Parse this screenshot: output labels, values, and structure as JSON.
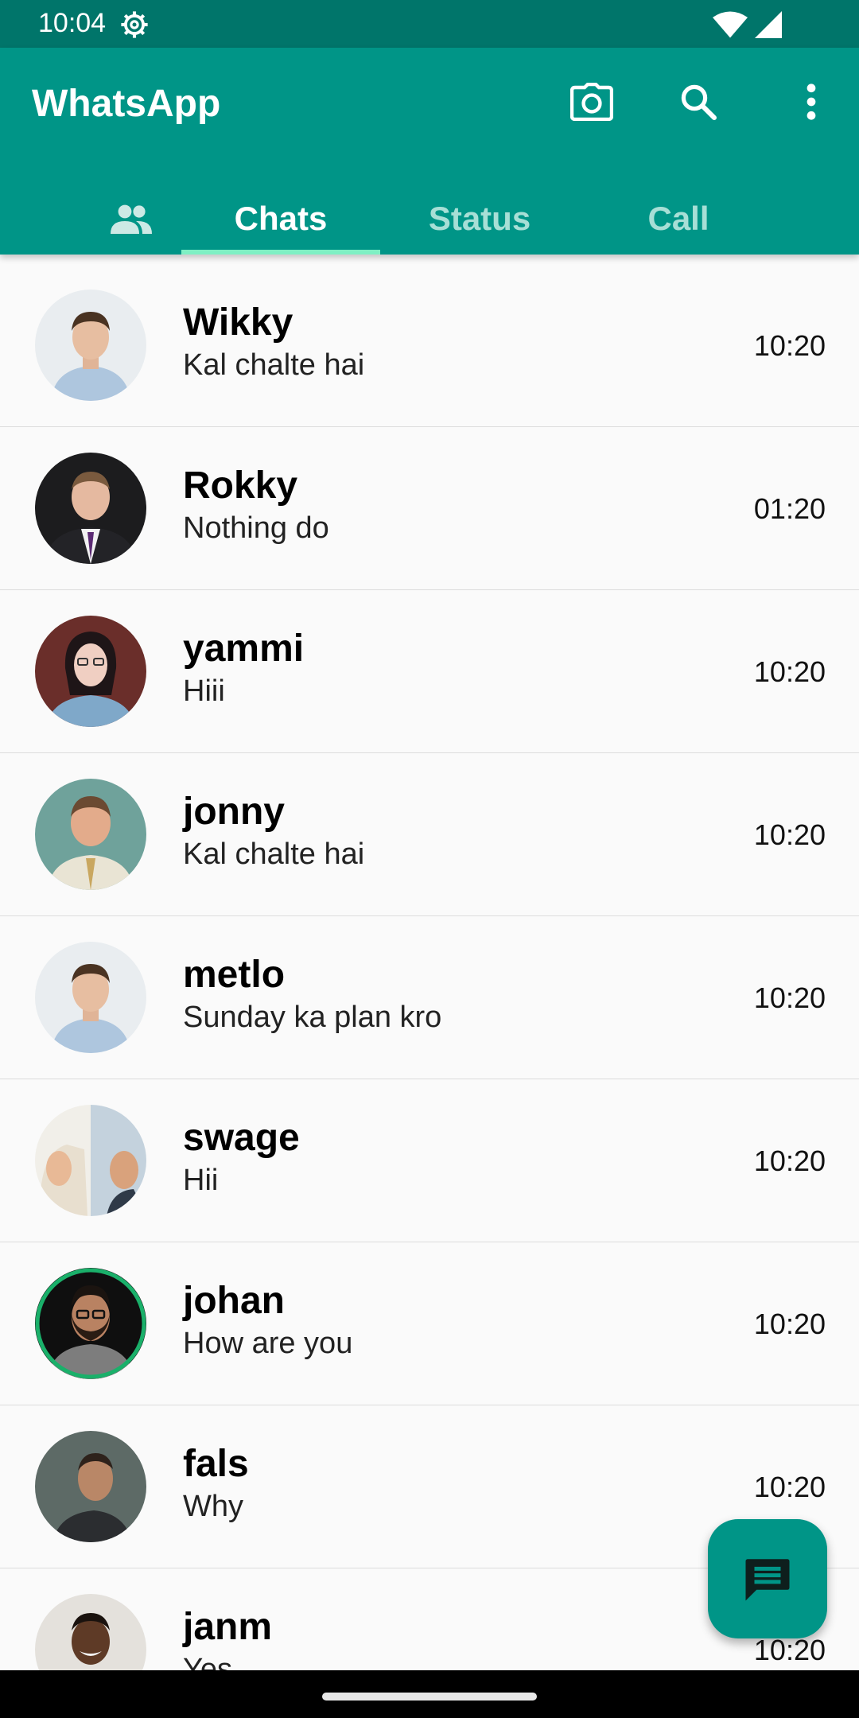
{
  "status_bar": {
    "time": "10:04"
  },
  "app_bar": {
    "title": "WhatsApp",
    "tabs": [
      {
        "label": "Chats",
        "selected": true
      },
      {
        "label": "Status",
        "selected": false
      },
      {
        "label": "Call",
        "selected": false
      }
    ]
  },
  "chats": [
    {
      "name": "Wikky",
      "message": "Kal chalte hai",
      "time": "10:20"
    },
    {
      "name": "Rokky",
      "message": "Nothing do",
      "time": "01:20"
    },
    {
      "name": "yammi",
      "message": "Hiii",
      "time": "10:20"
    },
    {
      "name": "jonny",
      "message": "Kal chalte hai",
      "time": "10:20"
    },
    {
      "name": "metlo",
      "message": "Sunday ka plan kro",
      "time": "10:20"
    },
    {
      "name": "swage",
      "message": "Hii",
      "time": "10:20"
    },
    {
      "name": "johan",
      "message": "How are you",
      "time": "10:20"
    },
    {
      "name": "fals",
      "message": "Why",
      "time": "10:20"
    },
    {
      "name": "janm",
      "message": "Yes",
      "time": "10:20"
    }
  ],
  "colors": {
    "primary": "#009587",
    "status_bar": "#00756a",
    "tab_indicator": "#7ff0c4"
  },
  "icons": {
    "status_bar": [
      "settings-gear-icon",
      "wifi-icon",
      "signal-icon"
    ],
    "app_bar": [
      "community-icon",
      "camera-icon",
      "search-icon",
      "more-vert-icon"
    ],
    "fab": "message-icon"
  }
}
